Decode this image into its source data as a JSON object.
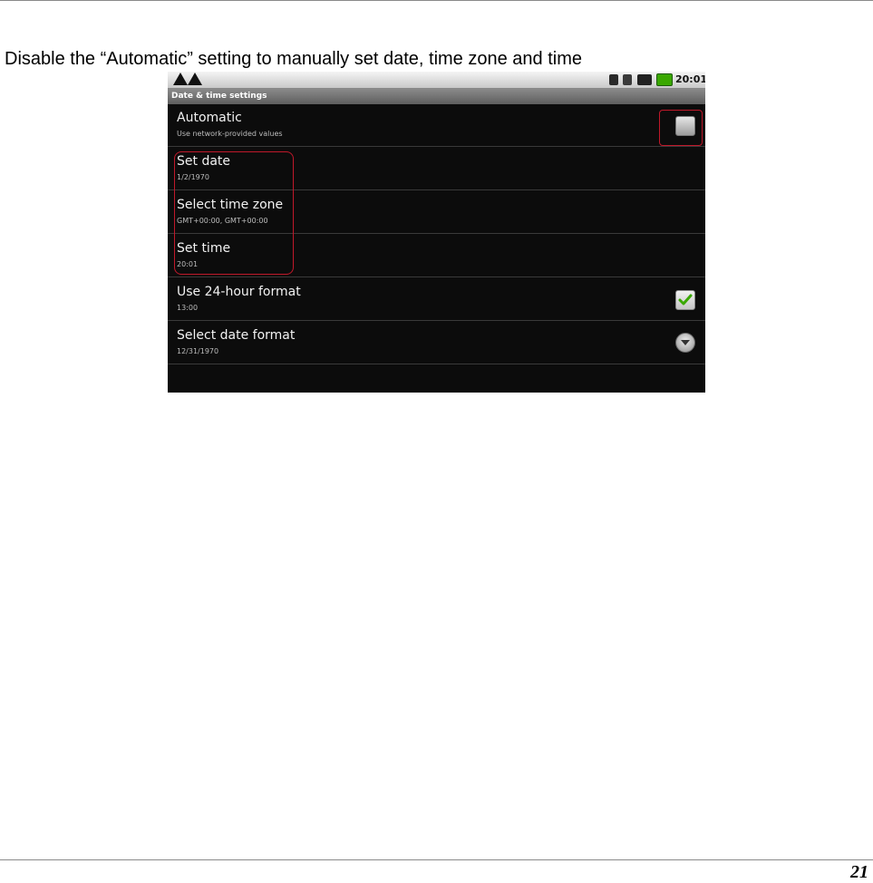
{
  "instruction": "Disable the “Automatic” setting to manually set date, time zone and time",
  "page_number": "21",
  "screen": {
    "status_bar": {
      "time": "20:01",
      "icons": [
        "warning-icon",
        "warning-icon",
        "usb-icon",
        "sd-card-icon",
        "signal-icon",
        "battery-icon"
      ]
    },
    "title": "Date & time settings",
    "items": [
      {
        "title": "Automatic",
        "summary": "Use network-provided values",
        "control": "checkbox",
        "checked": false
      },
      {
        "title": "Set date",
        "summary": "1/2/1970"
      },
      {
        "title": "Select time zone",
        "summary": "GMT+00:00, GMT+00:00"
      },
      {
        "title": "Set time",
        "summary": "20:01"
      },
      {
        "title": "Use 24-hour format",
        "summary": "13:00",
        "control": "checkbox",
        "checked": true
      },
      {
        "title": "Select date format",
        "summary": "12/31/1970",
        "control": "dropdown"
      }
    ],
    "highlight_color": "#c0182a",
    "check_color": "#3aa800"
  }
}
